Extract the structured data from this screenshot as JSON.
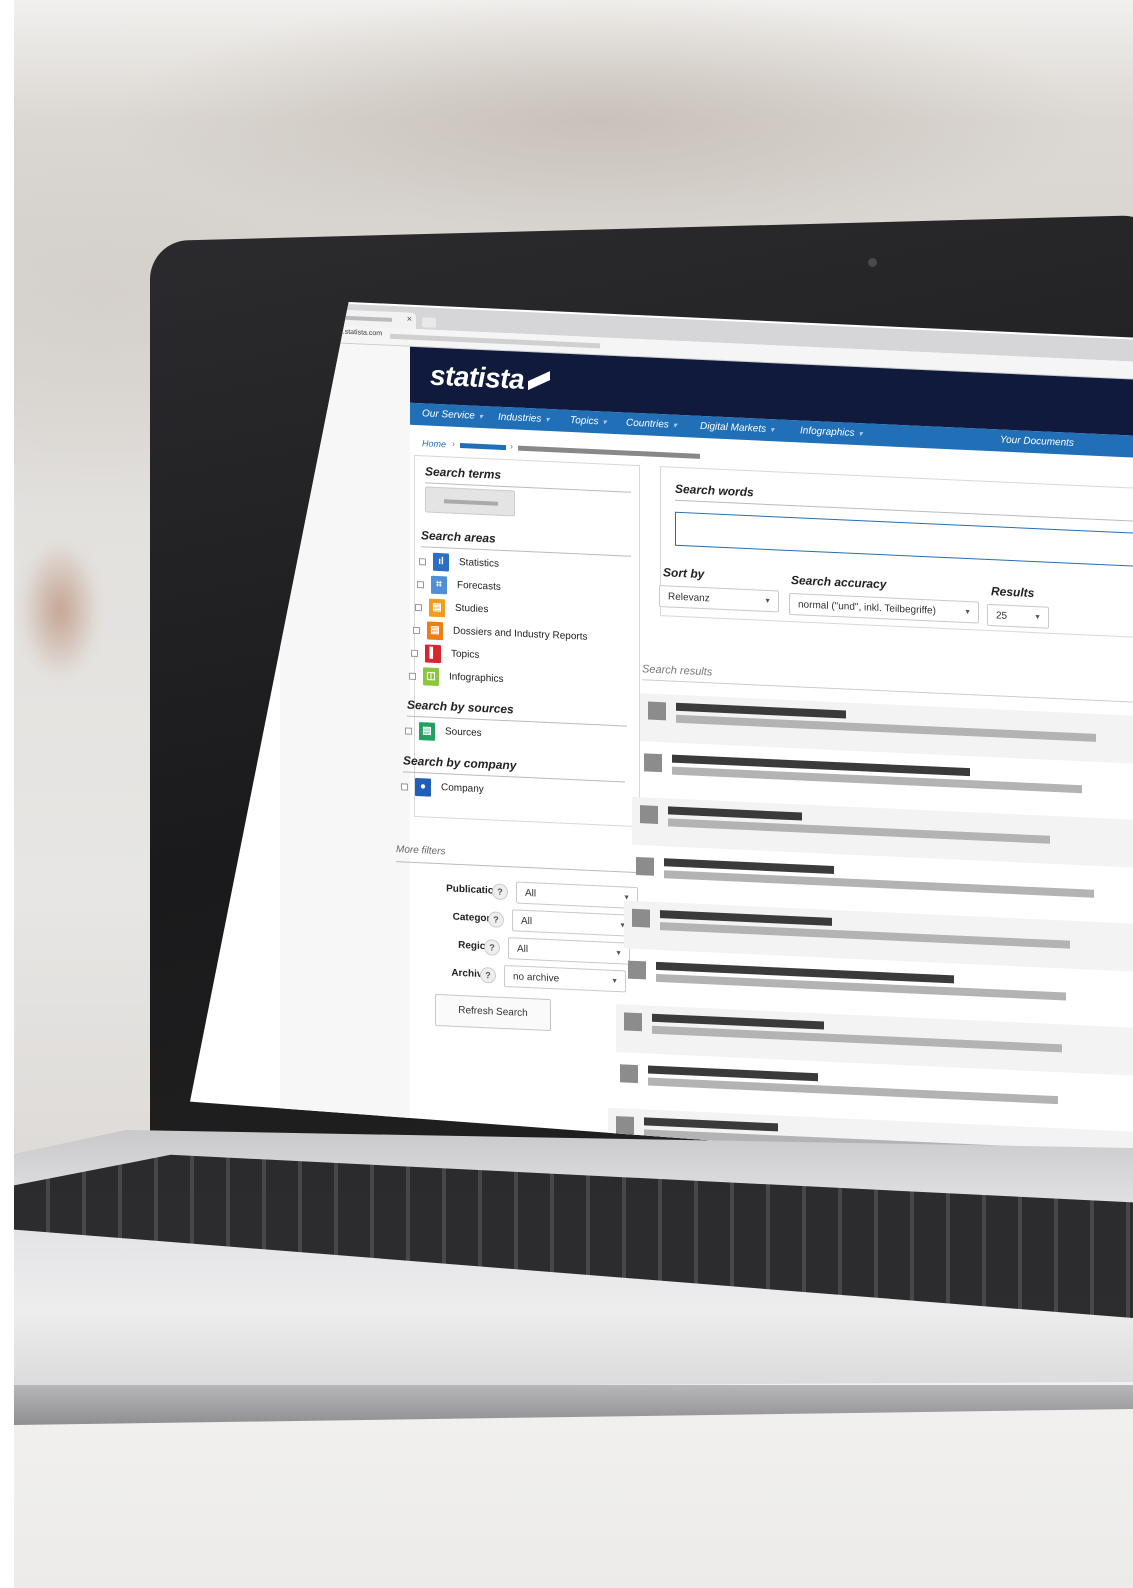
{
  "browser": {
    "url": "de.statista.com",
    "tab_close": "×"
  },
  "brand": {
    "logo": "statista",
    "colors": {
      "header": "#0f1a3d",
      "nav": "#2170b7"
    }
  },
  "nav": {
    "items": [
      "Our Service",
      "Industries",
      "Topics",
      "Countries",
      "Digital Markets",
      "Infographics",
      "Your Documents"
    ],
    "caret": "▾"
  },
  "breadcrumb": {
    "home": "Home",
    "separator": "›"
  },
  "filters": {
    "search_terms_title": "Search  terms",
    "search_areas_title": "Search areas",
    "areas": [
      {
        "label": "Statistics",
        "icon": "bar-chart-icon",
        "color": "#2a6fc2",
        "glyph": "ıl"
      },
      {
        "label": "Forecasts",
        "icon": "forecast-icon",
        "color": "#4f8fd6",
        "glyph": "⌗"
      },
      {
        "label": "Studies",
        "icon": "study-icon",
        "color": "#f39c1f",
        "glyph": "▤"
      },
      {
        "label": "Dossiers and Industry Reports",
        "icon": "dossier-icon",
        "color": "#ef7d14",
        "glyph": "▤"
      },
      {
        "label": "Topics",
        "icon": "topic-icon",
        "color": "#d8262f",
        "glyph": "▌"
      },
      {
        "label": "Infographics",
        "icon": "infographic-icon",
        "color": "#8cc63f",
        "glyph": "◫"
      }
    ],
    "sources_title": "Search by sources",
    "sources_label": "Sources",
    "sources_icon_color": "#23a163",
    "company_title": "Search by company",
    "company_label": "Company",
    "company_icon_color": "#1f5fb5"
  },
  "more_filters": {
    "title": "More filters",
    "rows": [
      {
        "label": "Publication",
        "help": "?",
        "value": "All"
      },
      {
        "label": "Category",
        "help": "?",
        "value": "All"
      },
      {
        "label": "Region",
        "help": "?",
        "value": "All"
      },
      {
        "label": "Archive",
        "help": "?",
        "value": "no archive"
      }
    ],
    "refresh_label": "Refresh Search"
  },
  "search": {
    "words_title": "Search words",
    "sort_label": "Sort by",
    "sort_value": "Relevanz",
    "accuracy_label": "Search accuracy",
    "accuracy_value": "normal (\"und\", inkl. Teilbegriffe)",
    "results_label": "Results",
    "results_value": "25",
    "results_header": "Search results"
  }
}
